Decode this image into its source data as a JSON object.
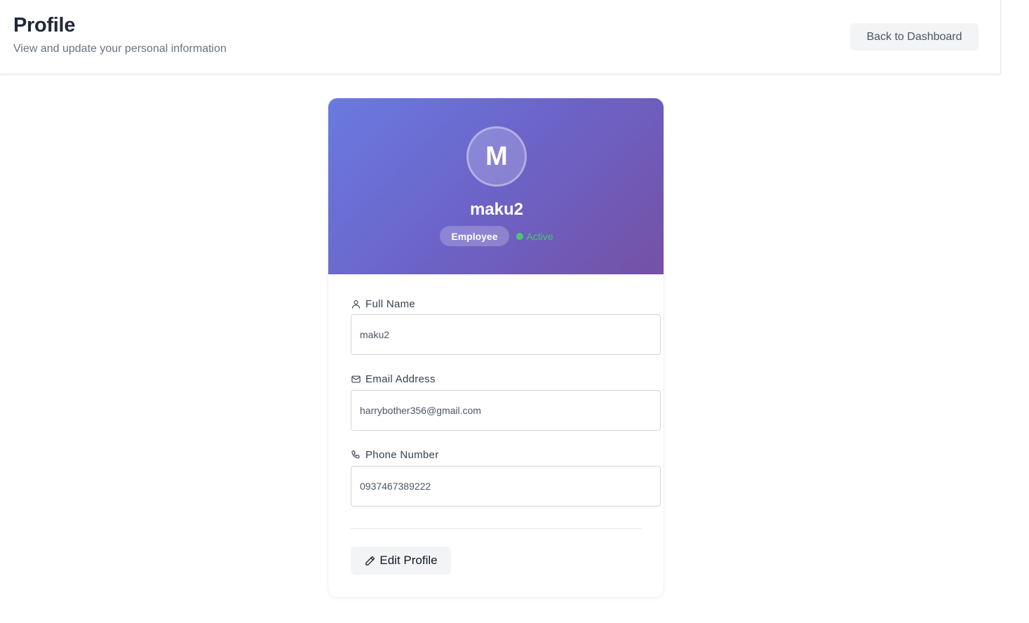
{
  "header": {
    "title": "Profile",
    "subtitle": "View and update your personal information",
    "back_label": "Back to Dashboard"
  },
  "profile": {
    "avatar_initial": "M",
    "name": "maku2",
    "role": "Employee",
    "status": "Active",
    "status_color": "#48c774"
  },
  "form": {
    "full_name": {
      "label": "Full Name",
      "value": "maku2",
      "icon": "user-icon"
    },
    "email": {
      "label": "Email Address",
      "value": "harrybother356@gmail.com",
      "icon": "mail-icon"
    },
    "phone": {
      "label": "Phone Number",
      "value": "0937467389222",
      "icon": "phone-icon"
    }
  },
  "actions": {
    "edit_label": "Edit Profile",
    "edit_icon": "pencil-icon"
  },
  "colors": {
    "banner_start": "#6a7ae0",
    "banner_end": "#7451a5"
  }
}
